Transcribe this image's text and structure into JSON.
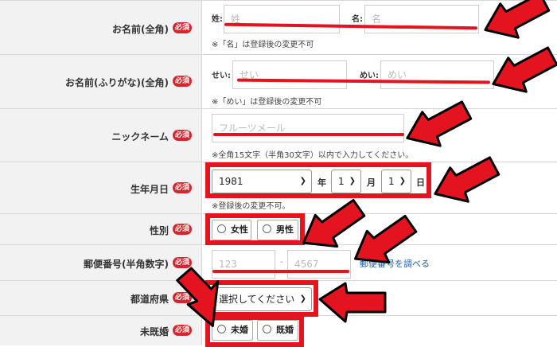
{
  "rows": [
    {
      "label": "お名前(全角)",
      "required": "必須"
    },
    {
      "label": "お名前(ふりがな)(全角)",
      "required": "必須"
    },
    {
      "label": "ニックネーム",
      "required": "必須"
    },
    {
      "label": "生年月日",
      "required": "必須"
    },
    {
      "label": "性別",
      "required": "必須"
    },
    {
      "label": "郵便番号(半角数字)",
      "required": "必須"
    },
    {
      "label": "都道府県",
      "required": "必須"
    },
    {
      "label": "未既婚",
      "required": "必須"
    }
  ],
  "name": {
    "sei_label": "姓:",
    "sei_placeholder": "姓",
    "mei_label": "名:",
    "mei_placeholder": "名",
    "note": "※「名」は登録後の変更不可"
  },
  "furigana": {
    "sei_label": "せい:",
    "sei_placeholder": "せい",
    "mei_label": "めい:",
    "mei_placeholder": "めい",
    "note": "※「めい」は登録後の変更不可"
  },
  "nickname": {
    "placeholder": "フルーツメール",
    "note": "※全角15文字（半角30文字）以内で入力してください。"
  },
  "birth": {
    "year": "1981",
    "year_unit": "年",
    "month": "1",
    "month_unit": "月",
    "day": "1",
    "day_unit": "日",
    "note": "※登録後の変更不可。"
  },
  "gender": {
    "female": "女性",
    "male": "男性"
  },
  "postal": {
    "first": "123",
    "sep": "-",
    "second": "4567",
    "lookup": "郵便番号を調べる"
  },
  "prefecture": {
    "selected": "選択してください"
  },
  "marital": {
    "unmarried": "未婚",
    "married": "既婚"
  },
  "colors": {
    "accent_red": "#e3141f",
    "required_badge": "#d8242c",
    "label_bg": "#f2f2f2"
  }
}
